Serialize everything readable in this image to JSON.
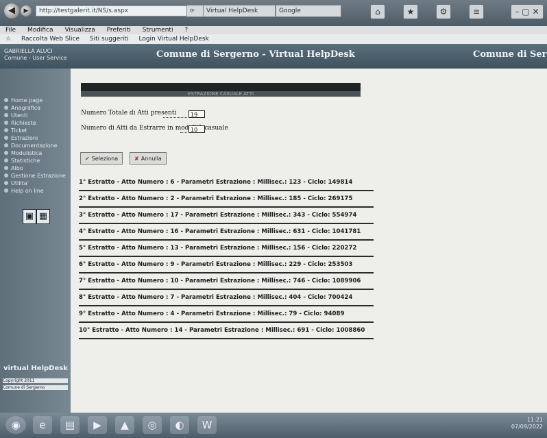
{
  "browser": {
    "address": "http://testgalerit.it/NS/s.aspx",
    "tabs": [
      "Virtual HelpDesk",
      "Google"
    ],
    "menu": [
      "File",
      "Modifica",
      "Visualizza",
      "Preferiti",
      "Strumenti",
      "?"
    ],
    "favorites": [
      "Raccolta Web Slice",
      "Siti suggeriti",
      "Login Virtual HelpDesk"
    ]
  },
  "banner": {
    "title": "Comune di Sergerno - Virtual HelpDesk",
    "title_right": "Comune di Sergerno",
    "user_line1": "GABRIELLA ALUCI",
    "user_line2": "Comune - User Service"
  },
  "sidebar": {
    "items": [
      "Home page",
      "Anagrafica",
      "Utenti",
      "Richieste",
      "Ticket",
      "Estrazioni",
      "Documentazione",
      "Modulistica",
      "Statistiche",
      "Albo",
      "Gestione Estrazione Atti",
      "Utilita'",
      "Help on line"
    ],
    "footer_title": "virtual HelpDesk",
    "footer_lines": [
      "Copyright 2011",
      "Comune di Sergerno"
    ]
  },
  "content": {
    "header_text": "ESTRAZIONE CASUALE ATTI",
    "total_label": "Numero Totale di Atti presenti",
    "total_value": "19",
    "extract_label": "Numero di Atti da Estrarre in modalità casuale",
    "extract_value": "10",
    "select_button": "Seleziona",
    "cancel_button": "Annulla",
    "results": [
      "1° Estratto - Atto Numero : 6 - Parametri Estrazione : Millisec.: 123 - Ciclo: 149814",
      "2° Estratto - Atto Numero : 2 - Parametri Estrazione : Millisec.: 185 - Ciclo: 269175",
      "3° Estratto - Atto Numero : 17 - Parametri Estrazione : Millisec.: 343 - Ciclo: 554974",
      "4° Estratto - Atto Numero : 16 - Parametri Estrazione : Millisec.: 631 - Ciclo: 1041781",
      "5° Estratto - Atto Numero : 13 - Parametri Estrazione : Millisec.: 156 - Ciclo: 220272",
      "6° Estratto - Atto Numero : 9 - Parametri Estrazione : Millisec.: 229 - Ciclo: 253503",
      "7° Estratto - Atto Numero : 10 - Parametri Estrazione : Millisec.: 746 - Ciclo: 1089906",
      "8° Estratto - Atto Numero : 7 - Parametri Estrazione : Millisec.: 404 - Ciclo: 700424",
      "9° Estratto - Atto Numero : 4 - Parametri Estrazione : Millisec.: 79 - Ciclo: 94089",
      "10° Estratto - Atto Numero : 14 - Parametri Estrazione : Millisec.: 691 - Ciclo: 1008860"
    ]
  },
  "taskbar": {
    "time": "11:21",
    "date": "07/09/2022"
  }
}
